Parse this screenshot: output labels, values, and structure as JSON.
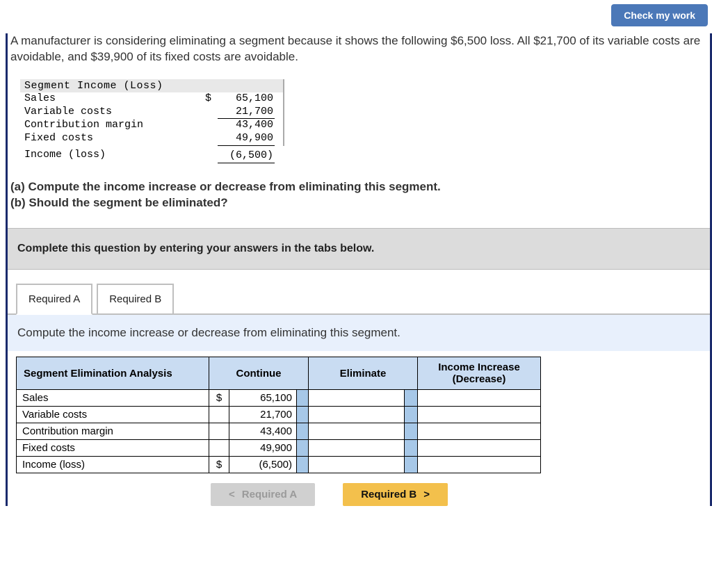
{
  "header": {
    "check_work": "Check my work"
  },
  "intro": "A manufacturer is considering eliminating a segment because it shows the following $6,500 loss. All $21,700 of its variable costs are avoidable, and $39,900 of its fixed costs are avoidable.",
  "segment_income": {
    "title": "Segment Income (Loss)",
    "rows": {
      "sales": {
        "label": "Sales",
        "dollar": "$",
        "value": "65,100"
      },
      "varcost": {
        "label": "Variable costs",
        "dollar": "",
        "value": "21,700"
      },
      "cm": {
        "label": "Contribution margin",
        "dollar": "",
        "value": "43,400"
      },
      "fixed": {
        "label": "Fixed costs",
        "dollar": "",
        "value": "49,900"
      },
      "income": {
        "label": "Income (loss)",
        "dollar": "",
        "value": "(6,500)"
      }
    }
  },
  "questions": {
    "a": "(a) Compute the income increase or decrease from eliminating this segment.",
    "b": "(b) Should the segment be eliminated?"
  },
  "complete_banner": "Complete this question by entering your answers in the tabs below.",
  "tabs": {
    "a": "Required A",
    "b": "Required B"
  },
  "panel": {
    "prompt": "Compute the income increase or decrease from eliminating this segment.",
    "headers": {
      "c1": "Segment Elimination Analysis",
      "c2": "Continue",
      "c3": "Eliminate",
      "c4": "Income Increase (Decrease)"
    },
    "rows": [
      {
        "label": "Sales",
        "dollar": "$",
        "continue": "65,100"
      },
      {
        "label": "Variable costs",
        "dollar": "",
        "continue": "21,700"
      },
      {
        "label": "Contribution margin",
        "dollar": "",
        "continue": "43,400"
      },
      {
        "label": "Fixed costs",
        "dollar": "",
        "continue": "49,900"
      },
      {
        "label": "Income (loss)",
        "dollar": "$",
        "continue": "(6,500)"
      }
    ]
  },
  "nav": {
    "prev": "Required A",
    "next": "Required B"
  }
}
